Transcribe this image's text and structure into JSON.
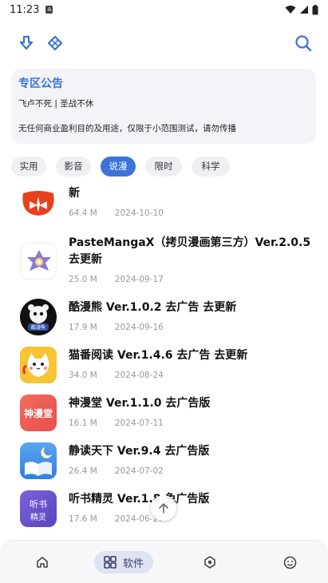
{
  "status_bar": {
    "time": "11:23",
    "sim_glyph": "A"
  },
  "top_bar": {
    "icons": [
      "download-icon",
      "diamond-icon",
      "search-icon"
    ]
  },
  "notice": {
    "title": "专区公告",
    "line1": "飞卢不死 | 圣战不休",
    "line2": "无任何商业盈利目的及用途，仅限于小范围测试，请勿传播"
  },
  "tabs": [
    {
      "label": "实用"
    },
    {
      "label": "影音"
    },
    {
      "label": "说漫"
    },
    {
      "label": "限时"
    },
    {
      "label": "科学"
    }
  ],
  "active_tab": "说漫",
  "items": [
    {
      "name": "新",
      "size": "64.4 M",
      "date": "2024-10-10"
    },
    {
      "name": "PasteMangaX（拷贝漫画第三方）Ver.2.0.5 去更新",
      "size": "25.0 M",
      "date": "2024-09-17"
    },
    {
      "name": "酷漫熊 Ver.1.0.2 去广告 去更新",
      "size": "17.9 M",
      "date": "2024-09-16"
    },
    {
      "name": "猫番阅读 Ver.1.4.6 去广告 去更新",
      "size": "34.0 M",
      "date": "2024-08-24"
    },
    {
      "name": "神漫堂 Ver.1.1.0 去广告版",
      "size": "16.1 M",
      "date": "2024-07-11"
    },
    {
      "name": "静读天下 Ver.9.4 去广告版",
      "size": "26.4 M",
      "date": "2024-07-02"
    },
    {
      "name": "听书精灵 Ver.1.8 免广告版",
      "size": "17.6 M",
      "date": "2024-06-27"
    }
  ],
  "icon_labels": {
    "kumanxiong": "酷漫熊",
    "shenmantang": "神漫堂",
    "tingshu_top": "听书",
    "tingshu_bottom": "精灵"
  },
  "bottom_nav": {
    "active_label": "软件",
    "items": [
      "home-icon",
      "apps-icon",
      "explore-icon",
      "profile-icon"
    ]
  },
  "colors": {
    "accent": "#3b73d6",
    "nav_active_bg": "#dfe2f2"
  }
}
